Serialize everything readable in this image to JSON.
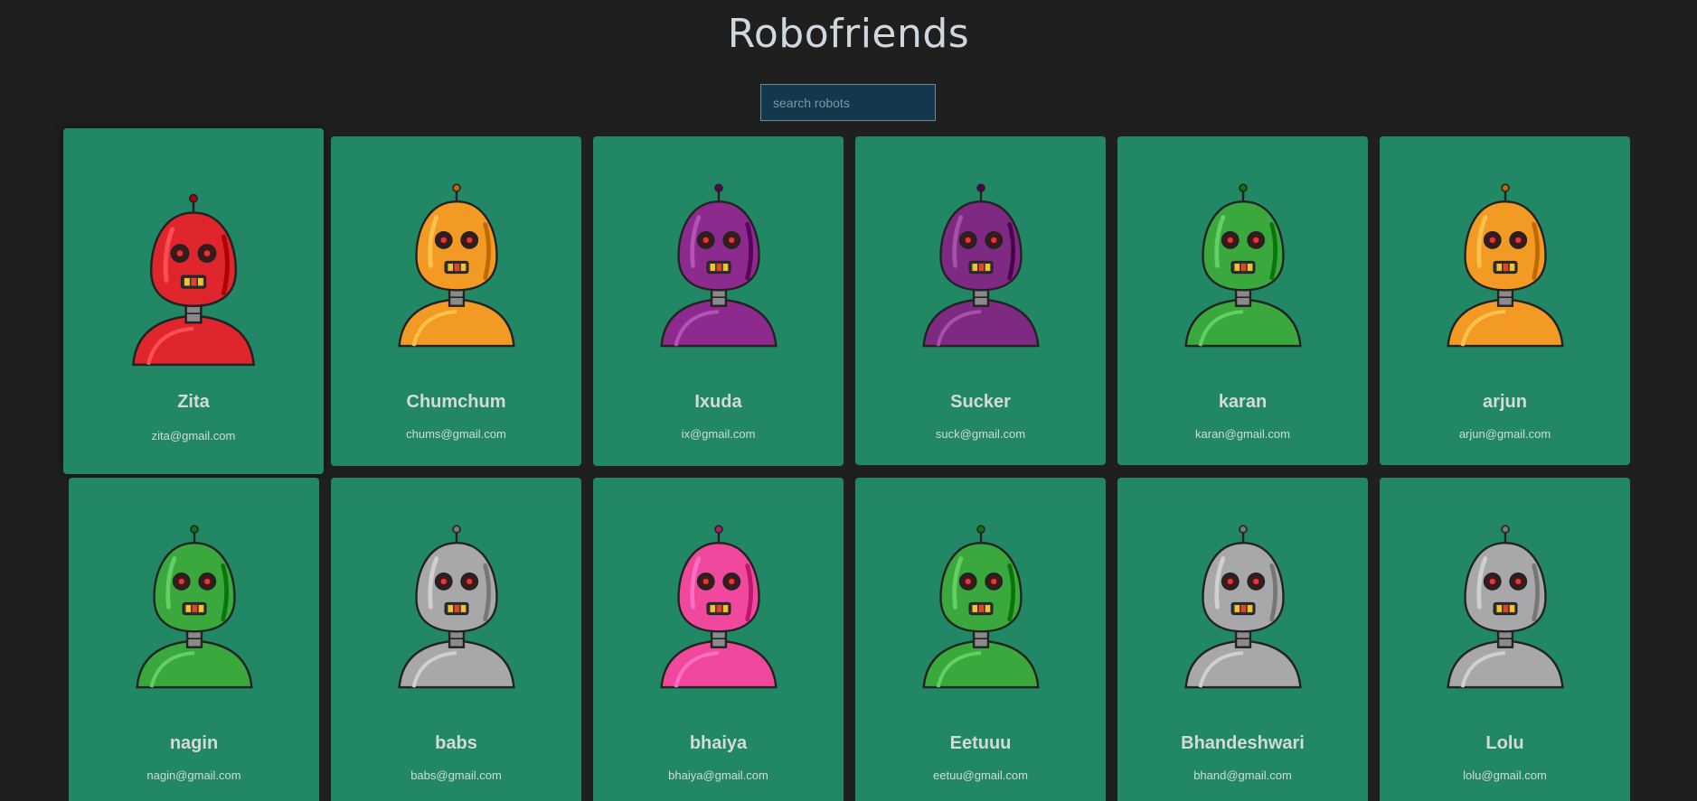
{
  "header": {
    "title": "Robofriends"
  },
  "search": {
    "placeholder": "search robots",
    "value": ""
  },
  "robots": [
    {
      "name": "Zita",
      "email": "zita@gmail.com",
      "color": "#e0262d",
      "icon": "robot-avatar-red"
    },
    {
      "name": "Chumchum",
      "email": "chums@gmail.com",
      "color": "#f39a24",
      "icon": "robot-avatar-orange"
    },
    {
      "name": "Ixuda",
      "email": "ix@gmail.com",
      "color": "#8c2a8e",
      "icon": "robot-avatar-purple"
    },
    {
      "name": "Sucker",
      "email": "suck@gmail.com",
      "color": "#7e2a82",
      "icon": "robot-avatar-purple"
    },
    {
      "name": "karan",
      "email": "karan@gmail.com",
      "color": "#3aa83c",
      "icon": "robot-avatar-green"
    },
    {
      "name": "arjun",
      "email": "arjun@gmail.com",
      "color": "#f39a24",
      "icon": "robot-avatar-orange"
    },
    {
      "name": "nagin",
      "email": "nagin@gmail.com",
      "color": "#3aa83c",
      "icon": "robot-avatar-green"
    },
    {
      "name": "babs",
      "email": "babs@gmail.com",
      "color": "#a8a8aa",
      "icon": "robot-avatar-gray"
    },
    {
      "name": "bhaiya",
      "email": "bhaiya@gmail.com",
      "color": "#f0489c",
      "icon": "robot-avatar-pink"
    },
    {
      "name": "Eetuuu",
      "email": "eetuu@gmail.com",
      "color": "#3aa83c",
      "icon": "robot-avatar-green"
    },
    {
      "name": "Bhandeshwari",
      "email": "bhand@gmail.com",
      "color": "#a8a8aa",
      "icon": "robot-avatar-gray"
    },
    {
      "name": "Lolu",
      "email": "lolu@gmail.com",
      "color": "#a8a8aa",
      "icon": "robot-avatar-gray"
    }
  ]
}
